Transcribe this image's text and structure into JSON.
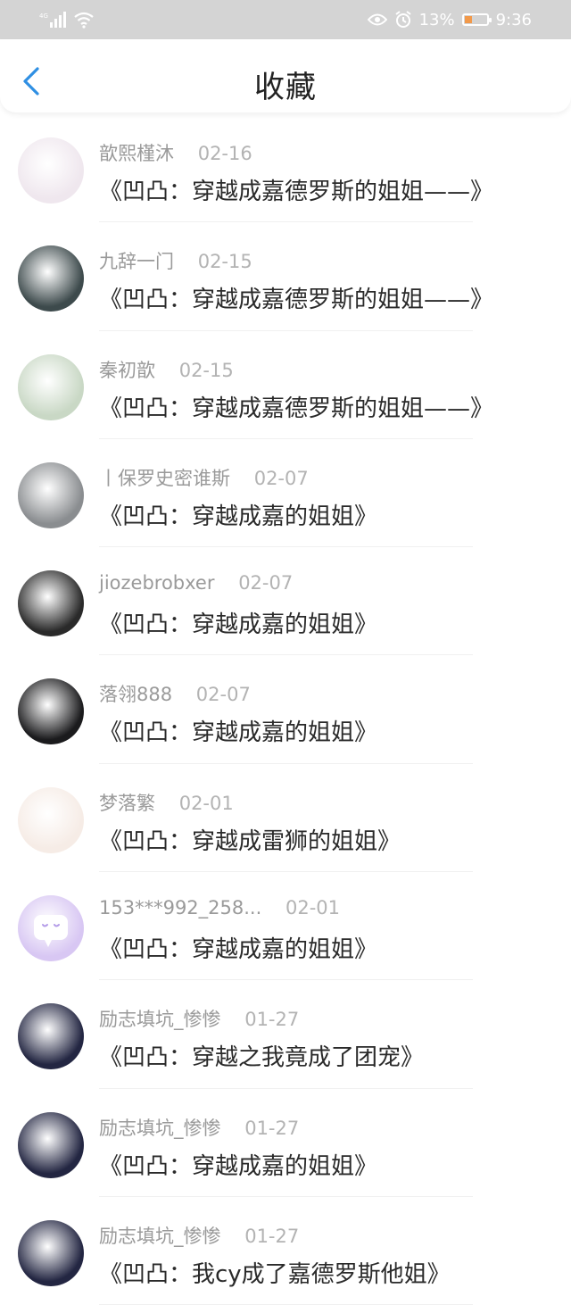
{
  "status_bar": {
    "network": "4G",
    "battery": "13%",
    "time": "9:36"
  },
  "header": {
    "title": "收藏"
  },
  "items": [
    {
      "author": "歆熙槿沐",
      "date": "02-16",
      "title": "《凹凸：穿越成嘉德罗斯的姐姐——》",
      "avatar_color": "#efe7ee"
    },
    {
      "author": "九辞一门",
      "date": "02-15",
      "title": "《凹凸：穿越成嘉德罗斯的姐姐——》",
      "avatar_color": "#3d4a4c"
    },
    {
      "author": "秦初歆",
      "date": "02-15",
      "title": "《凹凸：穿越成嘉德罗斯的姐姐——》",
      "avatar_color": "#c9d8c5"
    },
    {
      "author": "丨保罗史密谁斯",
      "date": "02-07",
      "title": "《凹凸：穿越成嘉的姐姐》",
      "avatar_color": "#8a8d90"
    },
    {
      "author": "jiozebrobxer",
      "date": "02-07",
      "title": "《凹凸：穿越成嘉的姐姐》",
      "avatar_color": "#2a2a2a"
    },
    {
      "author": "落翎888",
      "date": "02-07",
      "title": "《凹凸：穿越成嘉的姐姐》",
      "avatar_color": "#1b1b1d"
    },
    {
      "author": "梦落繁",
      "date": "02-01",
      "title": "《凹凸：穿越成雷狮的姐姐》",
      "avatar_color": "#f6ece6"
    },
    {
      "author": "153***992_258...",
      "date": "02-01",
      "title": "《凹凸：穿越成嘉的姐姐》",
      "avatar_color": "#d8c7f3"
    },
    {
      "author": "励志填坑_惨惨",
      "date": "01-27",
      "title": "《凹凸：穿越之我竟成了团宠》",
      "avatar_color": "#232642"
    },
    {
      "author": "励志填坑_惨惨",
      "date": "01-27",
      "title": "《凹凸：穿越成嘉的姐姐》",
      "avatar_color": "#232642"
    },
    {
      "author": "励志填坑_惨惨",
      "date": "01-27",
      "title": "《凹凸：我cy成了嘉德罗斯他姐》",
      "avatar_color": "#232642"
    }
  ]
}
